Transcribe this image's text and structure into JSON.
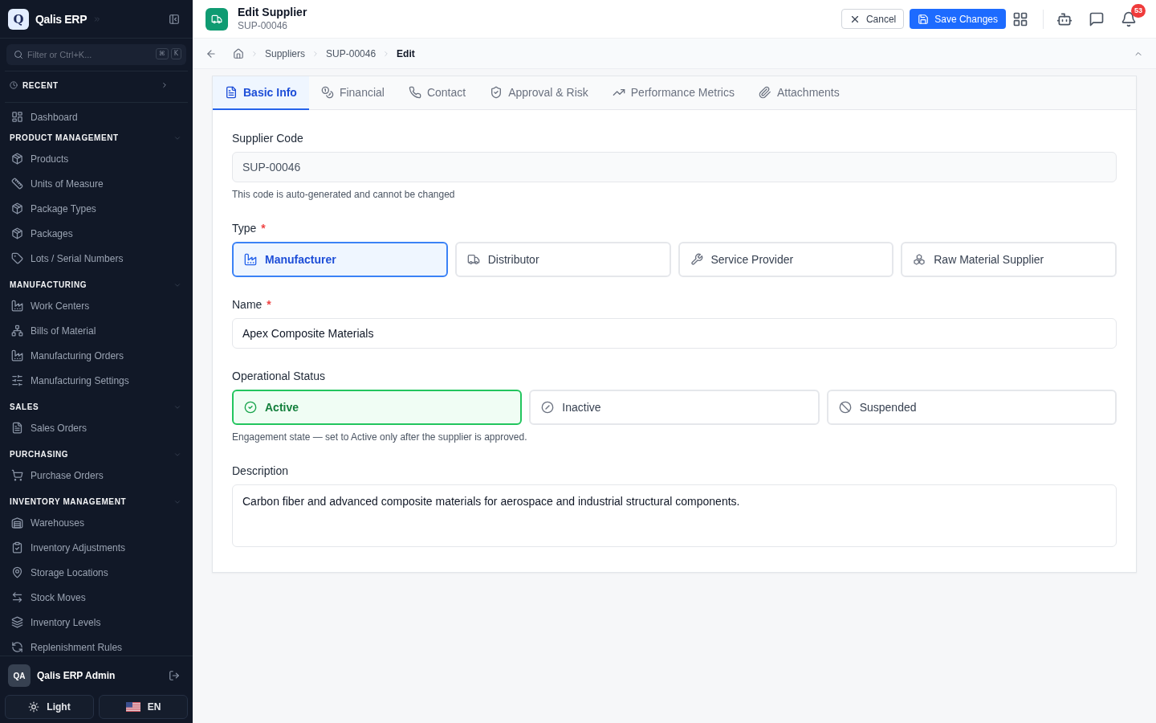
{
  "sidebar": {
    "brand": {
      "logo": "Q",
      "name": "Qalis ERP"
    },
    "search": {
      "placeholder": "Filter or Ctrl+K...",
      "shortcut_keys": [
        "⌘",
        "K"
      ]
    },
    "recent": {
      "label": "RECENT",
      "expanded": false
    },
    "nav": [
      {
        "items": [
          {
            "label": "Dashboard"
          }
        ]
      },
      {
        "title": "PRODUCT MANAGEMENT",
        "expanded": true,
        "items": [
          {
            "label": "Products"
          },
          {
            "label": "Units of Measure"
          },
          {
            "label": "Package Types"
          },
          {
            "label": "Packages"
          },
          {
            "label": "Lots / Serial Numbers"
          }
        ]
      },
      {
        "title": "MANUFACTURING",
        "expanded": true,
        "items": [
          {
            "label": "Work Centers"
          },
          {
            "label": "Bills of Material"
          },
          {
            "label": "Manufacturing Orders"
          },
          {
            "label": "Manufacturing Settings"
          }
        ]
      },
      {
        "title": "SALES",
        "expanded": true,
        "items": [
          {
            "label": "Sales Orders"
          }
        ]
      },
      {
        "title": "PURCHASING",
        "expanded": true,
        "items": [
          {
            "label": "Purchase Orders"
          }
        ]
      },
      {
        "title": "INVENTORY MANAGEMENT",
        "expanded": true,
        "items": [
          {
            "label": "Warehouses"
          },
          {
            "label": "Inventory Adjustments"
          },
          {
            "label": "Storage Locations"
          },
          {
            "label": "Stock Moves"
          },
          {
            "label": "Inventory Levels"
          },
          {
            "label": "Replenishment Rules"
          }
        ]
      }
    ],
    "user": {
      "initials": "QA",
      "name": "Qalis ERP Admin"
    },
    "theme_button": {
      "label": "Light"
    },
    "language_button": {
      "label": "EN"
    }
  },
  "header": {
    "title": "Edit Supplier",
    "subtitle": "SUP-00046",
    "cancel_button": "Cancel",
    "save_button": "Save Changes",
    "notification_count": "53"
  },
  "breadcrumb": [
    "Suppliers",
    "SUP-00046",
    "Edit"
  ],
  "tabs": [
    {
      "label": "Basic Info",
      "selected": true
    },
    {
      "label": "Financial",
      "selected": false
    },
    {
      "label": "Contact",
      "selected": false
    },
    {
      "label": "Approval & Risk",
      "selected": false
    },
    {
      "label": "Performance Metrics",
      "selected": false
    },
    {
      "label": "Attachments",
      "selected": false
    }
  ],
  "form": {
    "supplier_code": {
      "label": "Supplier Code",
      "value": "SUP-00046",
      "disabled": true,
      "help": "This code is auto-generated and cannot be changed"
    },
    "type": {
      "label": "Type",
      "required_mark": "*",
      "options": [
        {
          "label": "Manufacturer",
          "selected": true
        },
        {
          "label": "Distributor",
          "selected": false
        },
        {
          "label": "Service Provider",
          "selected": false
        },
        {
          "label": "Raw Material Supplier",
          "selected": false
        }
      ]
    },
    "name": {
      "label": "Name",
      "required_mark": "*",
      "value": "Apex Composite Materials"
    },
    "operational_status": {
      "label": "Operational Status",
      "options": [
        {
          "label": "Active",
          "selected": true
        },
        {
          "label": "Inactive",
          "selected": false
        },
        {
          "label": "Suspended",
          "selected": false
        }
      ],
      "help": "Engagement state — set to Active only after the supplier is approved."
    },
    "description": {
      "label": "Description",
      "value": "Carbon fiber and advanced composite materials for aerospace and industrial structural components."
    }
  }
}
